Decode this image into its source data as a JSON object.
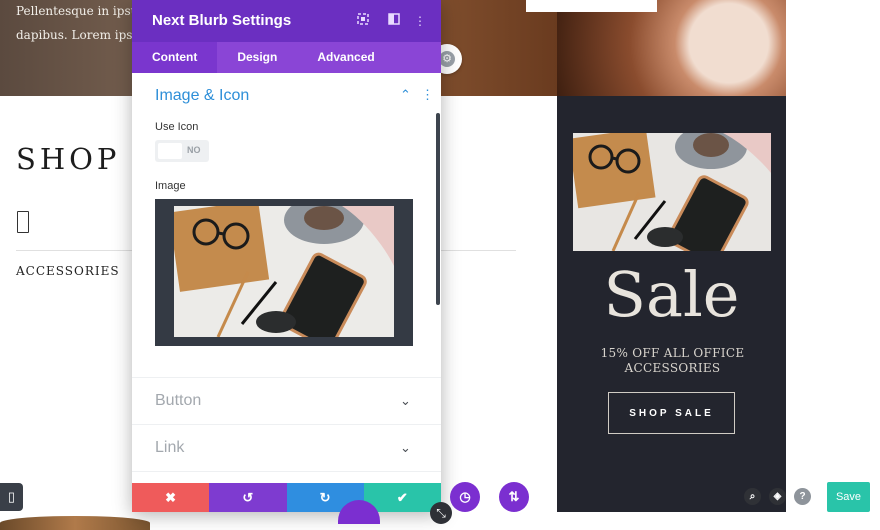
{
  "background": {
    "hero_text": "Pellentesque in ipsum dapibus. Lorem ipsum",
    "shop_title": "SHOP",
    "category": "ACCESSORIES",
    "promo": {
      "headline": "Sale",
      "subline": "15% OFF ALL OFFICE ACCESSORIES",
      "button_label": "SHOP SALE"
    }
  },
  "modal": {
    "title": "Next Blurb Settings",
    "tabs": [
      {
        "label": "Content",
        "active": true
      },
      {
        "label": "Design",
        "active": false
      },
      {
        "label": "Advanced",
        "active": false
      }
    ],
    "section": {
      "title": "Image & Icon",
      "use_icon_label": "Use Icon",
      "toggle_value": "NO",
      "image_label": "Image"
    },
    "collapsed_sections": [
      "Button",
      "Link"
    ],
    "footer": {
      "discard_icon": "close-icon",
      "undo_icon": "undo-icon",
      "redo_icon": "redo-icon",
      "save_icon": "check-icon"
    }
  },
  "toolbar": {
    "save_label": "Save"
  },
  "colors": {
    "modal_header": "#6b2fc1",
    "modal_tabs": "#8a45d6",
    "accent_blue": "#2e8fd8",
    "discard": "#ef5b5b",
    "undo": "#7e3bd0",
    "redo": "#2f8ee0",
    "confirm": "#29c4a9",
    "save": "#29c4a9",
    "dark_panel": "#23252e"
  }
}
